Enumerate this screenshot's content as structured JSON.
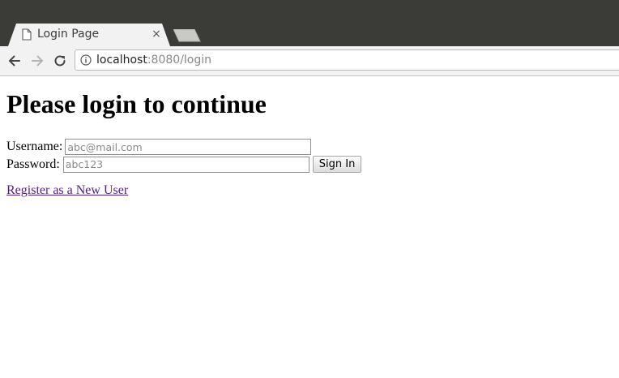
{
  "browser": {
    "tab": {
      "title": "Login Page",
      "close_glyph": "×",
      "icon": "page-icon"
    },
    "new_tab_icon": "new-tab-icon",
    "toolbar": {
      "back_icon": "back-arrow-icon",
      "forward_icon": "forward-arrow-icon",
      "reload_icon": "reload-icon",
      "site_info_icon": "info-icon"
    },
    "address": {
      "host": "localhost",
      "rest": ":8080/login"
    }
  },
  "page": {
    "title": "Please login to continue",
    "form": {
      "username_label": "Username:",
      "username_placeholder": "abc@mail.com",
      "username_value": "",
      "password_label": "Password:",
      "password_placeholder": "abc123",
      "password_value": "",
      "submit_label": "Sign In"
    },
    "register_link": "Register as a New User"
  },
  "colors": {
    "titlebar": "#3b3b38",
    "toolbar": "#f2f2f2",
    "visited_link": "#551a8b"
  }
}
